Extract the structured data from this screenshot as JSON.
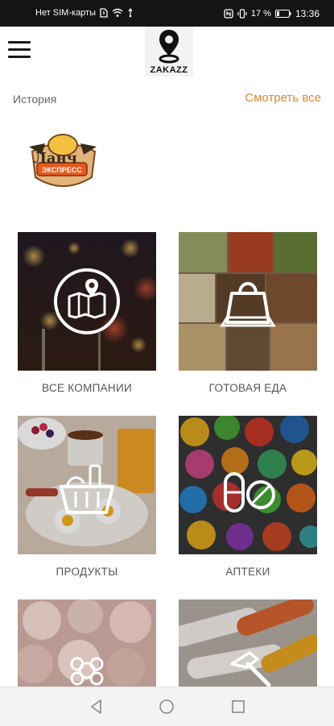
{
  "status": {
    "carrier": "Нет SIM-карты",
    "battery": "17 %",
    "time": "13:36"
  },
  "appbar": {
    "logo_text": "ZAKAZZ",
    "menu_icon": "hamburger-menu-icon"
  },
  "history": {
    "title": "История",
    "see_all": "Смотреть все",
    "logo_text_top": "Ланч",
    "logo_text_bottom": "ЭКСПРЕСС"
  },
  "categories": [
    {
      "label": "ВСЕ КОМПАНИИ",
      "icon": "map-icon"
    },
    {
      "label": "ГОТОВАЯ ЕДА",
      "icon": "takeaway-bag-icon"
    },
    {
      "label": "ПРОДУКТЫ",
      "icon": "grocery-basket-icon"
    },
    {
      "label": "АПТЕКИ",
      "icon": "pills-icon"
    },
    {
      "label": "",
      "icon": "flower-icon"
    },
    {
      "label": "",
      "icon": "hammer-icon"
    }
  ],
  "colors": {
    "accent": "#e08a2b",
    "statusbar": "#141414",
    "navbar": "#f3f3f3"
  }
}
